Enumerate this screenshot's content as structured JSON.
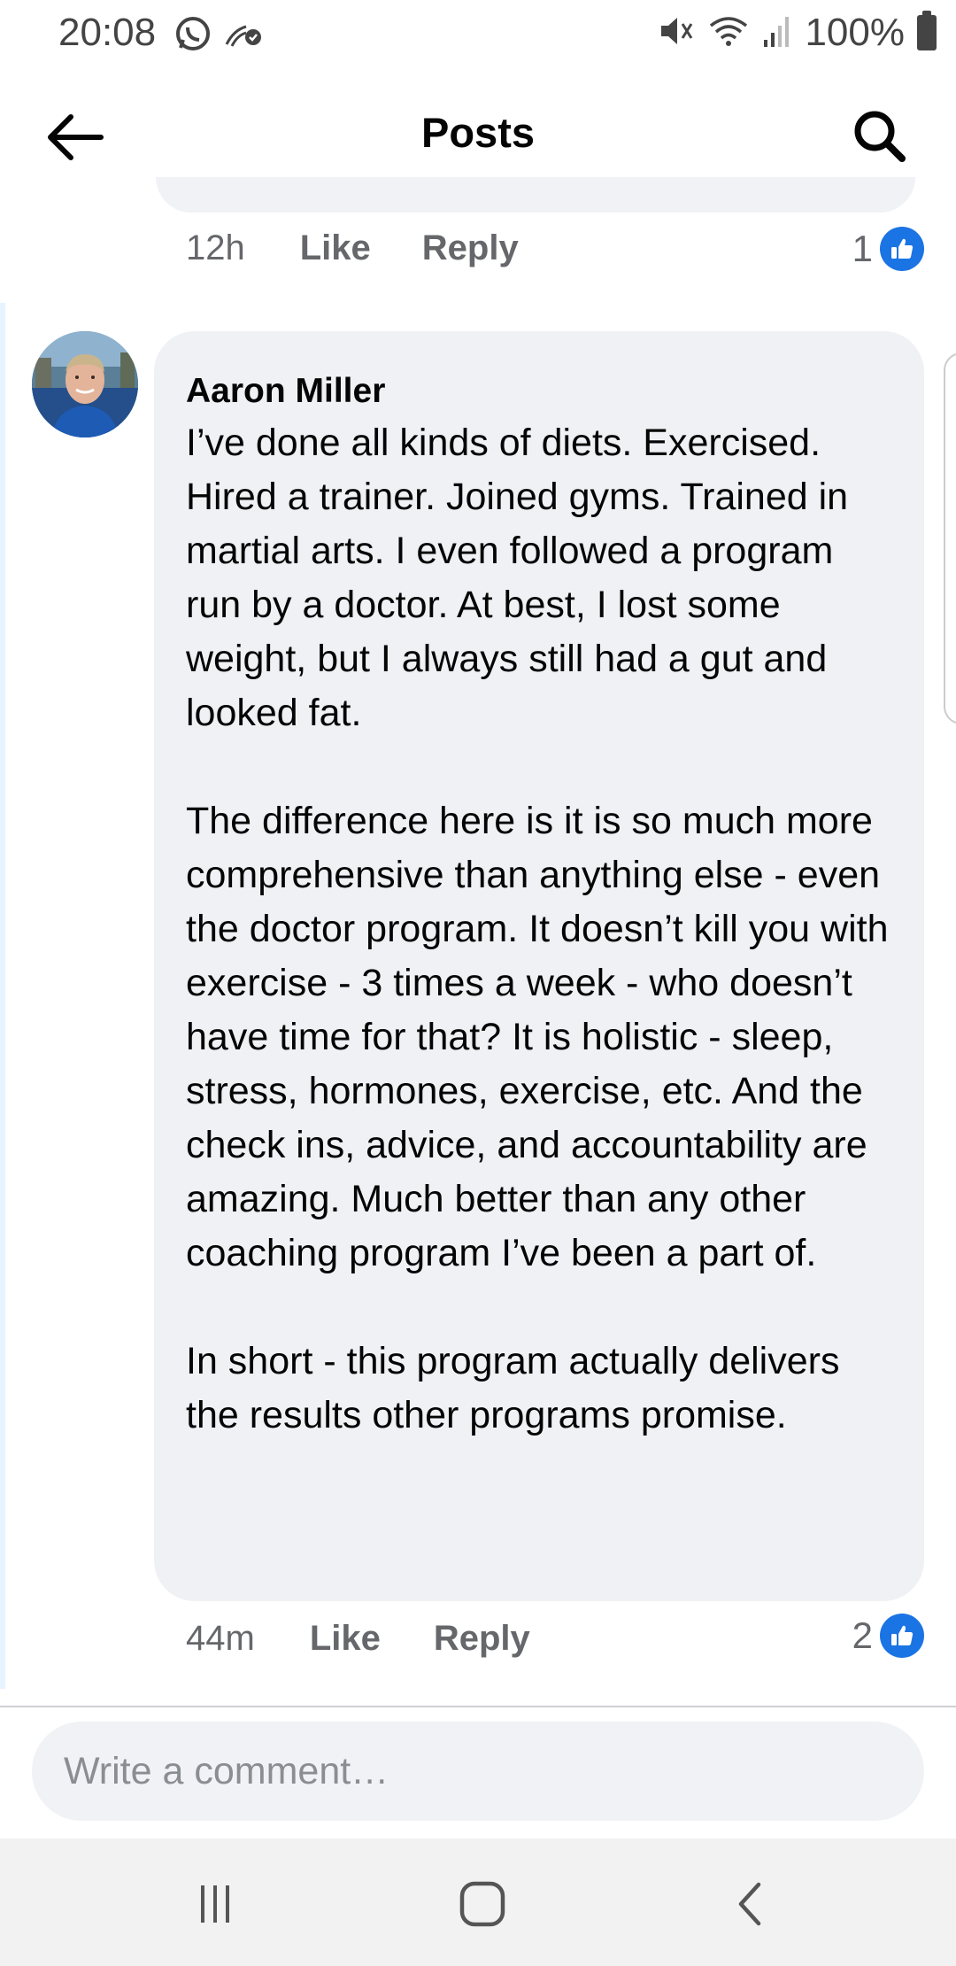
{
  "status_bar": {
    "time": "20:08",
    "battery": "100%",
    "icons": [
      "whatsapp-icon",
      "nfc-icon",
      "mute-icon",
      "wifi-icon",
      "signal-icon",
      "battery-icon"
    ]
  },
  "header": {
    "title": "Posts",
    "back_icon": "arrow-left-icon",
    "search_icon": "search-icon"
  },
  "previous_comment": {
    "time": "12h",
    "like_label": "Like",
    "reply_label": "Reply",
    "like_count": "1"
  },
  "comment": {
    "author": "Aaron Miller",
    "text": "I’ve done all kinds of diets. Exercised. Hired a trainer. Joined gyms. Trained in martial arts. I even followed a program run by a doctor. At best, I lost some weight, but I always still had a gut and looked fat.\n\nThe difference here is it is so much more comprehensive than anything else - even the doctor program. It doesn’t kill you with exercise - 3 times a week - who doesn’t have time for that? It is holistic - sleep, stress, hormones, exercise, etc. And the check ins, advice, and accountability are amazing. Much better than any other coaching program I’ve been a part of.\n\nIn short - this program actually delivers the results other programs promise.",
    "time": "44m",
    "like_label": "Like",
    "reply_label": "Reply",
    "like_count": "2"
  },
  "composer": {
    "placeholder": "Write a comment…"
  },
  "nav_bar": {
    "icons": [
      "recent-apps-icon",
      "home-icon",
      "back-icon"
    ]
  },
  "colors": {
    "accent": "#1b74e4",
    "bubble": "#eff1f5",
    "secondary_text": "#65676b"
  }
}
